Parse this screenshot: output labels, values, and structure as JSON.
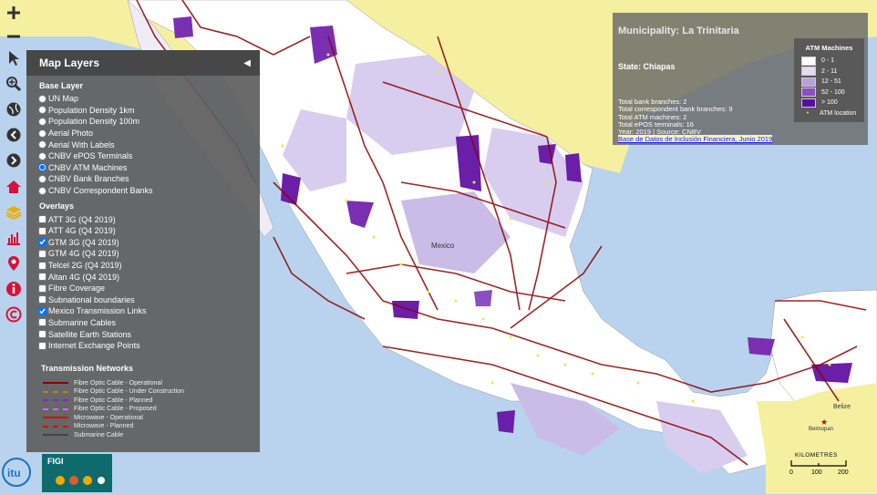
{
  "toolbar": {
    "tools": [
      "zoom-in-icon",
      "zoom-out-icon",
      "pointer-icon",
      "zoom-area-icon",
      "globe-icon",
      "back-icon",
      "forward-icon",
      "home-icon",
      "layers-icon",
      "chart-icon",
      "pin-icon",
      "info-icon",
      "copyright-icon"
    ]
  },
  "panel": {
    "title": "Map Layers",
    "base_title": "Base Layer",
    "base": [
      {
        "label": "UN Map",
        "checked": false
      },
      {
        "label": "Population Density 1km",
        "checked": false
      },
      {
        "label": "Population Density 100m",
        "checked": false
      },
      {
        "label": "Aerial Photo",
        "checked": false
      },
      {
        "label": "Aerial With Labels",
        "checked": false
      },
      {
        "label": "CNBV ePOS Terminals",
        "checked": false
      },
      {
        "label": "CNBV ATM Machines",
        "checked": true
      },
      {
        "label": "CNBV Bank Branches",
        "checked": false
      },
      {
        "label": "CNBV Correspondent Banks",
        "checked": false
      }
    ],
    "overlays_title": "Overlays",
    "overlays": [
      {
        "label": "ATT 3G (Q4 2019)",
        "checked": false
      },
      {
        "label": "ATT 4G (Q4 2019)",
        "checked": false
      },
      {
        "label": "GTM 3G (Q4 2019)",
        "checked": true
      },
      {
        "label": "GTM 4G (Q4 2019)",
        "checked": false
      },
      {
        "label": "Telcel 2G (Q4 2019)",
        "checked": false
      },
      {
        "label": "Altan 4G (Q4 2019)",
        "checked": false
      },
      {
        "label": "Fibre Coverage",
        "checked": false
      },
      {
        "label": "Subnational boundaries",
        "checked": false
      },
      {
        "label": "Mexico Transmission Links",
        "checked": true
      },
      {
        "label": "Submarine Cables",
        "checked": false
      },
      {
        "label": "Satellite Earth Stations",
        "checked": false
      },
      {
        "label": "Internet Exchange Points",
        "checked": false
      }
    ],
    "networks_title": "Transmission Networks",
    "networks": [
      {
        "label": "Fibre Optic Cable - Operational",
        "color": "#8b0000",
        "style": "solid"
      },
      {
        "label": "Fibre Optic Cable - Under Construction",
        "color": "#b8860b",
        "style": "dashed"
      },
      {
        "label": "Fibre Optic Cable - Planned",
        "color": "#7b2cbf",
        "style": "dashed"
      },
      {
        "label": "Fibre Optic Cable - Proposed",
        "color": "#e066e0",
        "style": "dashed"
      },
      {
        "label": "Microwave - Operational",
        "color": "#e00000",
        "style": "solid"
      },
      {
        "label": "Microwave - Planned",
        "color": "#e00000",
        "style": "dashed"
      },
      {
        "label": "Submarine Cable",
        "color": "#444444",
        "style": "solid"
      }
    ]
  },
  "info": {
    "title": "Municipality: La Trinitaria",
    "state": "State: Chiapas",
    "lines": [
      "Total bank branches: 2",
      "Total correspondent bank branches: 9",
      "Total ATM machines: 2",
      "Total ePOS terminals: 16",
      "Year: 2019 | Source: CNBV"
    ],
    "link": "Base de Datos de Inclusión Financiera, Junio 2019"
  },
  "atm_legend": {
    "title": "ATM Machines",
    "classes": [
      {
        "label": "0 - 1",
        "color": "#ffffff"
      },
      {
        "label": "2 - 11",
        "color": "#e3dcf2"
      },
      {
        "label": "12 - 51",
        "color": "#b6a3dc"
      },
      {
        "label": "52 - 100",
        "color": "#8b4fc2"
      },
      {
        "label": "> 100",
        "color": "#5a0f9c"
      }
    ],
    "location_label": "ATM location"
  },
  "map_labels": {
    "mexico": "Mexico",
    "belize": "Belize",
    "belmopan": "Belmopan"
  },
  "scale": {
    "title": "KILOMETRES",
    "ticks": [
      "0",
      "100",
      "200"
    ]
  },
  "logos": {
    "figi": "FIGI"
  },
  "colors": {
    "sea": "#b9d3ee",
    "land": "#f5f0a0",
    "fibre": "#8b0000"
  }
}
